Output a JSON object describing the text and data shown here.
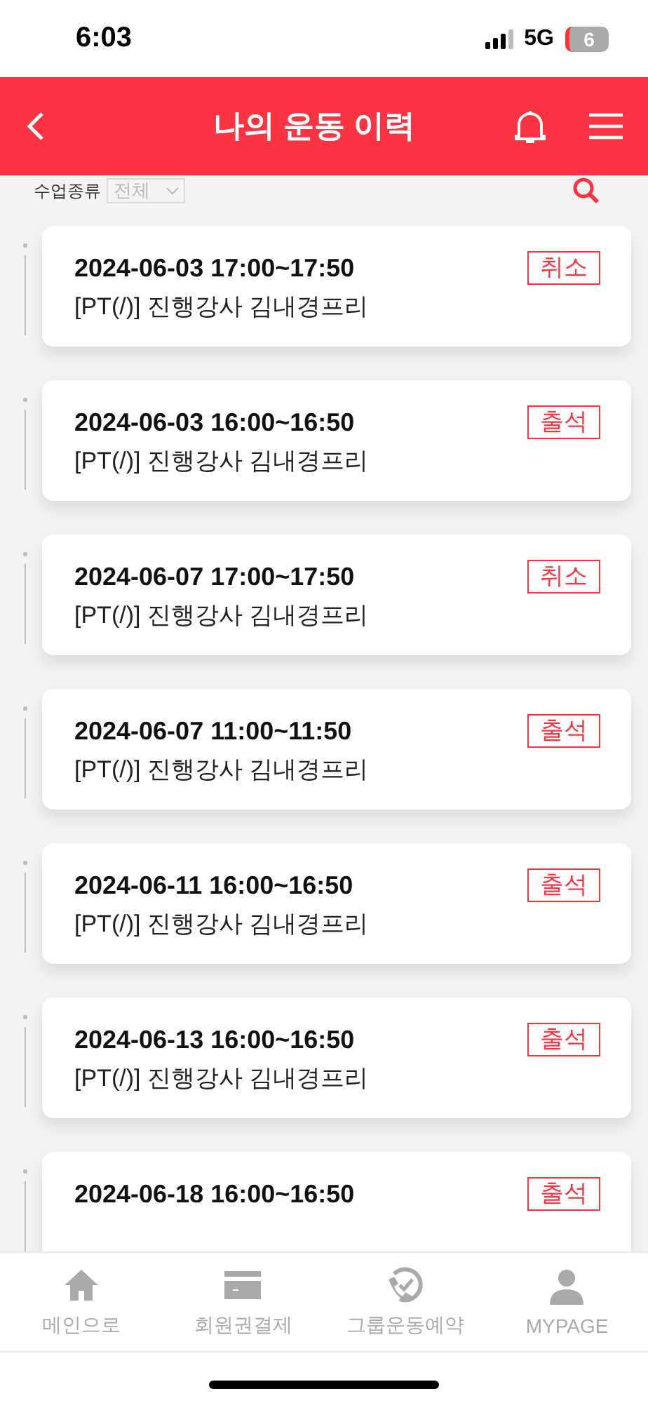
{
  "status_bar": {
    "time": "6:03",
    "network": "5G",
    "battery": "6"
  },
  "header": {
    "title": "나의 운동 이력"
  },
  "filter": {
    "label": "수업종류",
    "value": "전체"
  },
  "records": [
    {
      "datetime": "2024-06-03 17:00~17:50",
      "detail": "[PT(/)] 진행강사 김내경프리",
      "status": "취소"
    },
    {
      "datetime": "2024-06-03 16:00~16:50",
      "detail": "[PT(/)] 진행강사 김내경프리",
      "status": "출석"
    },
    {
      "datetime": "2024-06-07 17:00~17:50",
      "detail": "[PT(/)] 진행강사 김내경프리",
      "status": "취소"
    },
    {
      "datetime": "2024-06-07 11:00~11:50",
      "detail": "[PT(/)] 진행강사 김내경프리",
      "status": "출석"
    },
    {
      "datetime": "2024-06-11 16:00~16:50",
      "detail": "[PT(/)] 진행강사 김내경프리",
      "status": "출석"
    },
    {
      "datetime": "2024-06-13 16:00~16:50",
      "detail": "[PT(/)] 진행강사 김내경프리",
      "status": "출석"
    },
    {
      "datetime": "2024-06-18 16:00~16:50",
      "status": "출석"
    }
  ],
  "tab_bar": [
    {
      "kind": "home",
      "label": "메인으로"
    },
    {
      "kind": "card",
      "label": "회원권결제"
    },
    {
      "kind": "phone",
      "label": "그룹운동예약"
    },
    {
      "kind": "person",
      "label": "MYPAGE"
    }
  ]
}
